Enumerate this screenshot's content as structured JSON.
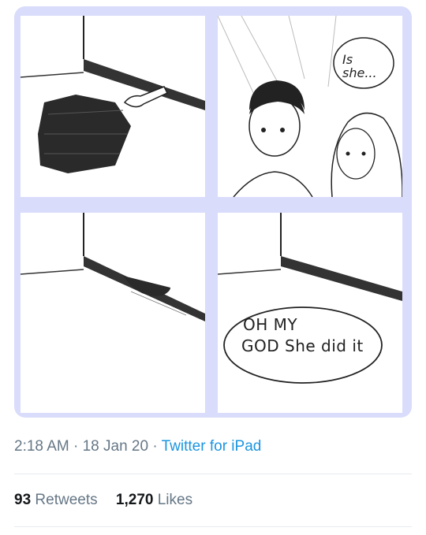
{
  "comic": {
    "panel2_bubble": "Is she...",
    "panel4_bubble_line1": "OH MY",
    "panel4_bubble_line2": "GOD She did it"
  },
  "tweet_meta": {
    "time": "2:18 AM",
    "separator": "·",
    "date": "18 Jan 20",
    "source": "Twitter for iPad"
  },
  "stats": {
    "retweets_count": "93",
    "retweets_label": "Retweets",
    "likes_count": "1,270",
    "likes_label": "Likes"
  },
  "colors": {
    "comic_border": "#d9dcfb",
    "link_blue": "#1b95e0",
    "secondary_text": "#657786"
  }
}
